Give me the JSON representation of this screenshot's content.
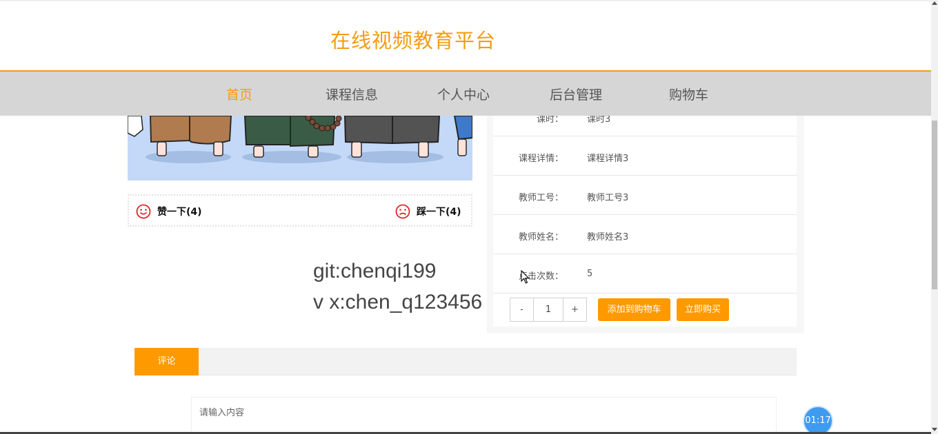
{
  "header": {
    "title": "在线视频教育平台"
  },
  "nav": {
    "items": [
      {
        "label": "首页",
        "active": true
      },
      {
        "label": "课程信息",
        "active": false
      },
      {
        "label": "个人中心",
        "active": false
      },
      {
        "label": "后台管理",
        "active": false
      },
      {
        "label": "购物车",
        "active": false
      }
    ],
    "active_color": "#f39c12"
  },
  "votes": {
    "like_label": "赞一下(4)",
    "dislike_label": "踩一下(4)",
    "icon_color": "#e0242b"
  },
  "watermark": {
    "line1": "git:chenqi199",
    "line2": "v x:chen_q123456"
  },
  "details": {
    "rows": [
      {
        "label": "课时：",
        "value": "课时3"
      },
      {
        "label": "课程详情：",
        "value": "课程详情3"
      },
      {
        "label": "教师工号：",
        "value": "教师工号3"
      },
      {
        "label": "教师姓名：",
        "value": "教师姓名3"
      },
      {
        "label": "点击次数：",
        "value": "5"
      }
    ]
  },
  "purchase": {
    "minus": "-",
    "quantity": "1",
    "plus": "+",
    "add_to_cart": "添加到购物车",
    "buy_now": "立即购买",
    "button_color": "#ff9900"
  },
  "tabs": {
    "active_label": "评论"
  },
  "comment": {
    "placeholder": "请输入内容"
  },
  "timer": {
    "text": "01:17"
  }
}
